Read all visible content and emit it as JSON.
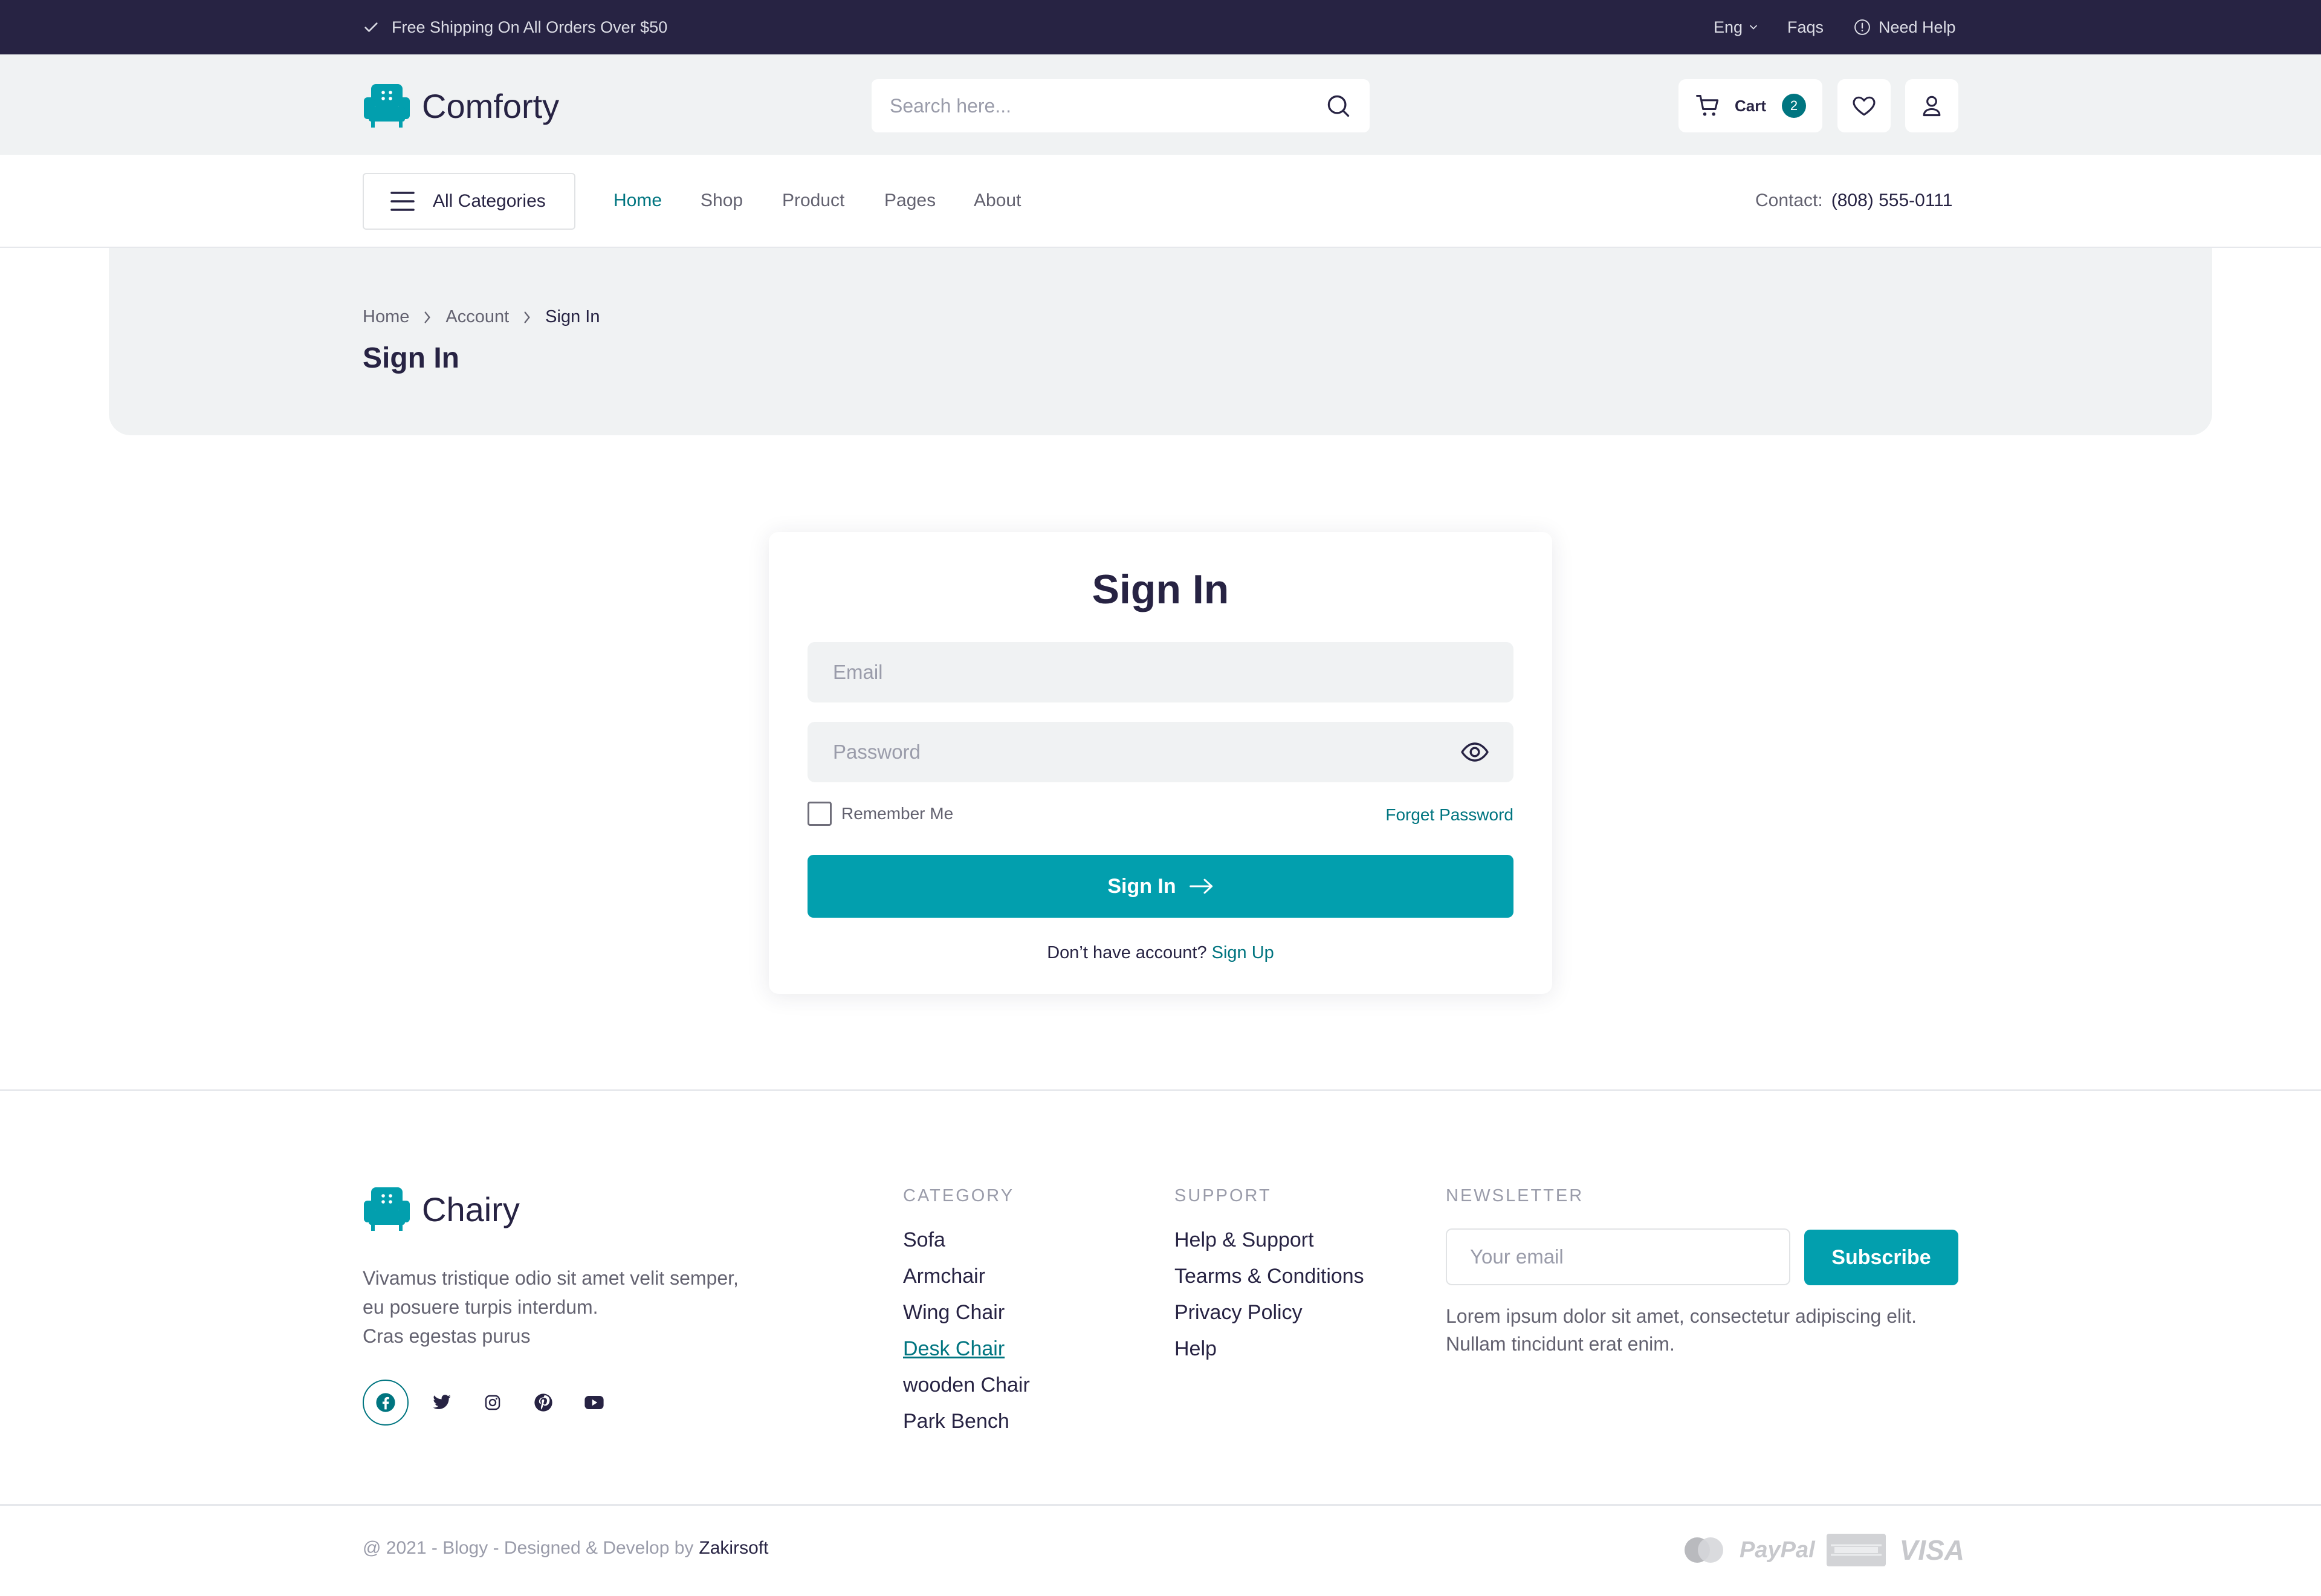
{
  "topbar": {
    "shipping": "Free Shipping On All Orders Over $50",
    "language": "Eng",
    "faqs": "Faqs",
    "help": "Need Help"
  },
  "header": {
    "brand": "Comforty",
    "search_placeholder": "Search here...",
    "cart_label": "Cart",
    "cart_count": "2"
  },
  "nav": {
    "all_categories": "All Categories",
    "links": [
      "Home",
      "Shop",
      "Product",
      "Pages",
      "About"
    ],
    "active": "Home",
    "contact_label": "Contact:",
    "contact_phone": "(808) 555-0111"
  },
  "hero": {
    "breadcrumb": [
      "Home",
      "Account",
      "Sign In"
    ],
    "title": "Sign In"
  },
  "signin": {
    "title": "Sign In",
    "email_placeholder": "Email",
    "password_placeholder": "Password",
    "remember": "Remember Me",
    "forgot": "Forget Password",
    "button": "Sign In",
    "no_account": "Don’t have account?",
    "signup": "Sign Up"
  },
  "footer": {
    "brand": "Chairy",
    "about_lines": [
      "Vivamus tristique odio sit amet velit semper,",
      "eu posuere turpis interdum.",
      "Cras egestas purus"
    ],
    "category_head": "CATEGORY",
    "category_items": [
      "Sofa",
      "Armchair",
      "Wing Chair",
      "Desk Chair",
      "wooden Chair",
      "Park Bench"
    ],
    "support_head": "SUPPORT",
    "support_items": [
      "Help & Support",
      "Tearms & Conditions",
      "Privacy Policy",
      "Help"
    ],
    "newsletter_head": "NEWSLETTER",
    "newsletter_placeholder": "Your email",
    "subscribe": "Subscribe",
    "newsletter_text_1": "Lorem ipsum dolor sit amet, consectetur adipiscing elit.",
    "newsletter_text_2": "Nullam tincidunt erat enim.",
    "copyright_prefix": "@ 2021 - Blogy - Designed & Develop by",
    "copyright_author": "Zakirsoft",
    "payments": [
      "PayPal",
      "VISA"
    ]
  },
  "colors": {
    "dark": "#272343",
    "accent": "#029fae",
    "accent_dark": "#007580",
    "header_bg": "#f0f2f3"
  },
  "icons": [
    "check-icon",
    "chevron-down-icon",
    "info-icon",
    "sofa-logo-icon",
    "search-icon",
    "cart-icon",
    "heart-icon",
    "user-icon",
    "menu-icon",
    "chevron-right-icon",
    "eye-icon",
    "arrow-right-icon",
    "facebook-icon",
    "twitter-icon",
    "instagram-icon",
    "pinterest-icon",
    "youtube-icon",
    "mastercard-icon",
    "paypal-icon",
    "amex-icon",
    "visa-icon"
  ]
}
